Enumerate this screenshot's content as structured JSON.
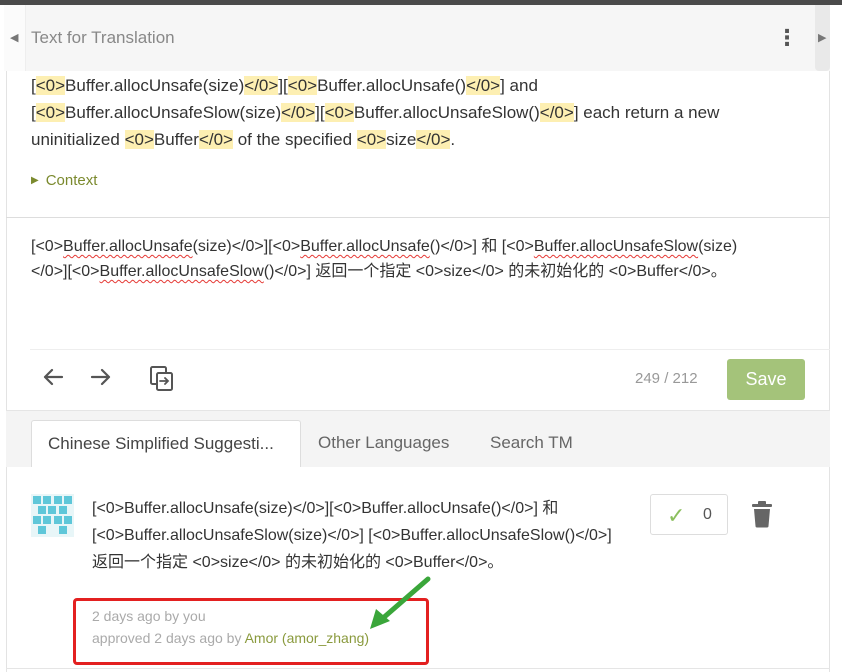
{
  "header": {
    "title": "Text for Translation"
  },
  "source": {
    "segments": [
      {
        "t": "[",
        "tag": false
      },
      {
        "t": "<0>",
        "tag": true
      },
      {
        "t": "Buffer.allocUnsafe(size)",
        "tag": false
      },
      {
        "t": "</0>",
        "tag": true
      },
      {
        "t": "][",
        "tag": false
      },
      {
        "t": "<0>",
        "tag": true
      },
      {
        "t": "Buffer.allocUnsafe()",
        "tag": false
      },
      {
        "t": "</0>",
        "tag": true
      },
      {
        "t": "] and [",
        "tag": false
      },
      {
        "t": "<0>",
        "tag": true
      },
      {
        "t": "Buffer.allocUnsafeSlow(size)",
        "tag": false
      },
      {
        "t": "</0>",
        "tag": true
      },
      {
        "t": "][",
        "tag": false
      },
      {
        "t": "<0>",
        "tag": true
      },
      {
        "t": "Buffer.allocUnsafeSlow()",
        "tag": false
      },
      {
        "t": "</0>",
        "tag": true
      },
      {
        "t": "] each return a new uninitialized ",
        "tag": false
      },
      {
        "t": "<0>",
        "tag": true
      },
      {
        "t": "Buffer",
        "tag": false
      },
      {
        "t": "</0>",
        "tag": true
      },
      {
        "t": " of the specified ",
        "tag": false
      },
      {
        "t": "<0>",
        "tag": true
      },
      {
        "t": "size",
        "tag": false
      },
      {
        "t": "</0>",
        "tag": true
      },
      {
        "t": ".",
        "tag": false
      }
    ]
  },
  "context": {
    "label": "Context"
  },
  "translation": {
    "segments": [
      {
        "t": "[<0>",
        "sq": false
      },
      {
        "t": "Buffer.allocUnsafe",
        "sq": true
      },
      {
        "t": "(size)</0>][<0>",
        "sq": false
      },
      {
        "t": "Buffer.allocUnsafe",
        "sq": true
      },
      {
        "t": "()</0>] 和 [<0>",
        "sq": false
      },
      {
        "t": "Buffer.allocUnsafeSlow",
        "sq": true
      },
      {
        "t": "(size)</0>][<0>",
        "sq": false
      },
      {
        "t": "Buffer.allocUnsafeSlow",
        "sq": true
      },
      {
        "t": "()</0>] 返回一个指定 <0>size</0> 的未初始化的 <0>Buffer</0>。",
        "sq": false
      }
    ]
  },
  "toolbar": {
    "counter": "249 / 212",
    "save_label": "Save"
  },
  "tabs": [
    {
      "label": "Chinese Simplified Suggesti..."
    },
    {
      "label": "Other Languages"
    },
    {
      "label": "Search TM"
    }
  ],
  "suggestion": {
    "text": "[<0>Buffer.allocUnsafe(size)</0>][<0>Buffer.allocUnsafe()</0>] 和 [<0>Buffer.allocUnsafeSlow(size)</0>] [<0>Buffer.allocUnsafeSlow()</0>] 返回一个指定 <0>size</0> 的未初始化的 <0>Buffer</0>。",
    "votes": "0",
    "meta_created": "2 days ago by you",
    "meta_approved_prefix": "approved 2 days ago by ",
    "meta_approved_user": "Amor (amor_zhang)"
  },
  "colors": {
    "accent": "#a4c37a",
    "tag_highlight": "#fdefb2",
    "context_green": "#7b8a2e",
    "annotation_red": "#e32020",
    "annotation_arrow": "#3aa63a"
  },
  "icons": [
    "chevron-left-icon",
    "chevron-right-icon",
    "kebab-menu-icon",
    "context-triangle-icon",
    "arrow-left-icon",
    "arrow-right-icon",
    "copy-source-icon",
    "check-icon",
    "trash-icon",
    "avatar-identicon"
  ]
}
